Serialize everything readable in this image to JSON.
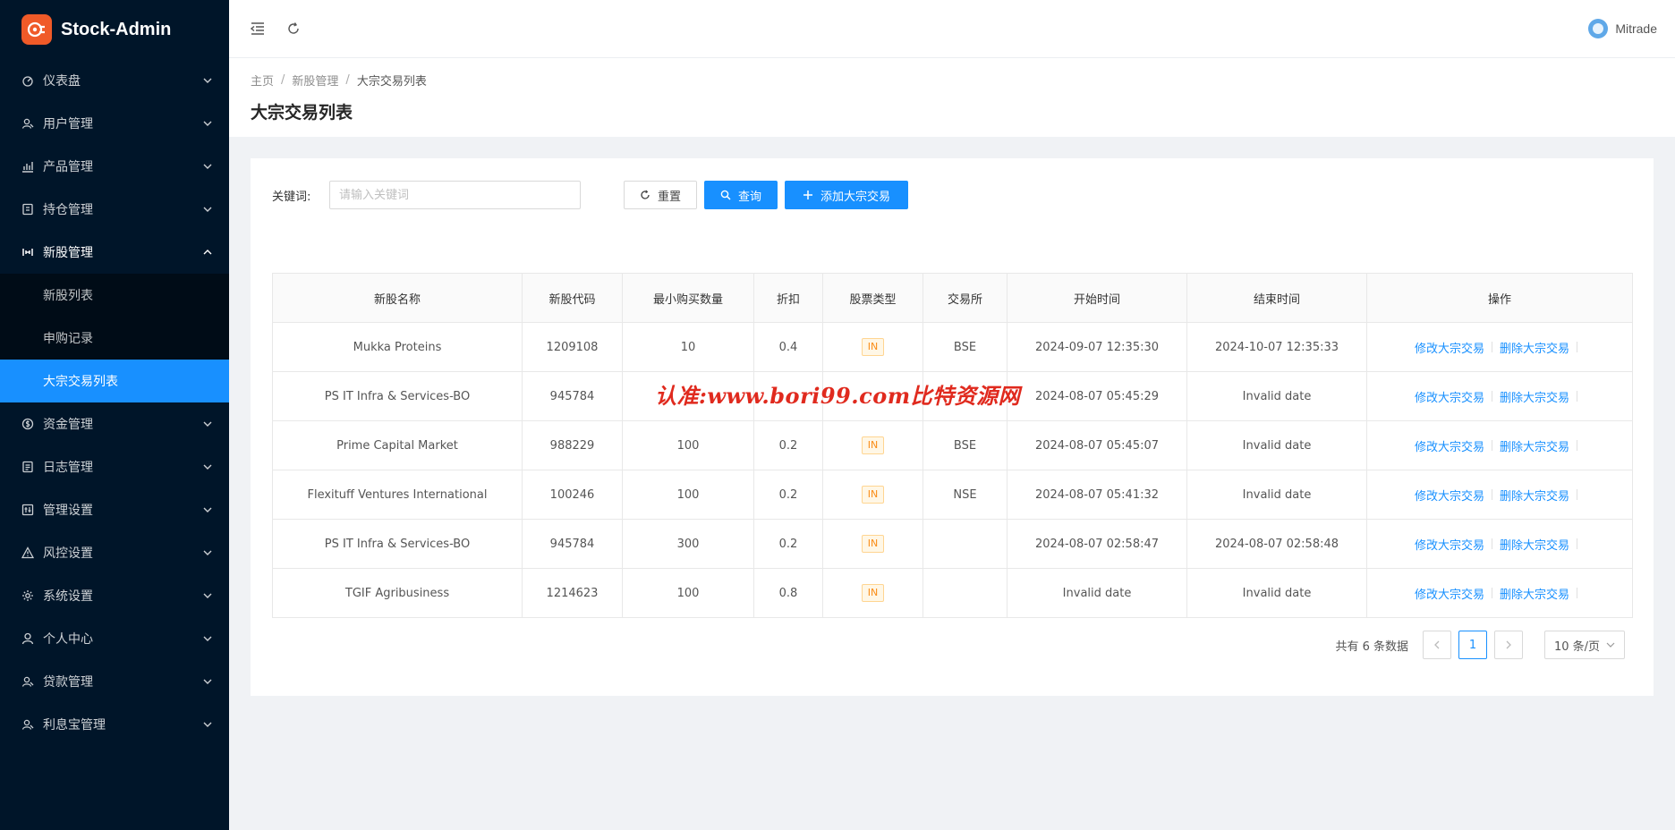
{
  "app": {
    "title": "Stock-Admin"
  },
  "sidebar": {
    "items": [
      {
        "label": "仪表盘",
        "icon": "dashboard-icon"
      },
      {
        "label": "用户管理",
        "icon": "users-icon"
      },
      {
        "label": "产品管理",
        "icon": "chart-icon"
      },
      {
        "label": "持仓管理",
        "icon": "position-icon"
      },
      {
        "label": "新股管理",
        "icon": "ipo-icon",
        "open": true
      },
      {
        "label": "资金管理",
        "icon": "money-icon"
      },
      {
        "label": "日志管理",
        "icon": "log-icon"
      },
      {
        "label": "管理设置",
        "icon": "admin-settings-icon"
      },
      {
        "label": "风控设置",
        "icon": "warning-icon"
      },
      {
        "label": "系统设置",
        "icon": "gear-icon"
      },
      {
        "label": "个人中心",
        "icon": "user-icon"
      },
      {
        "label": "贷款管理",
        "icon": "loan-icon"
      },
      {
        "label": "利息宝管理",
        "icon": "interest-icon"
      }
    ],
    "submenu": [
      {
        "label": "新股列表"
      },
      {
        "label": "申购记录"
      },
      {
        "label": "大宗交易列表",
        "active": true
      }
    ]
  },
  "header": {
    "username": "Mitrade"
  },
  "breadcrumb": [
    "主页",
    "新股管理",
    "大宗交易列表"
  ],
  "page_title": "大宗交易列表",
  "filter": {
    "label": "关键词:",
    "placeholder": "请输入关键词",
    "reset_label": "重置",
    "search_label": "查询",
    "add_label": "添加大宗交易"
  },
  "table": {
    "columns": [
      "新股名称",
      "新股代码",
      "最小购买数量",
      "折扣",
      "股票类型",
      "交易所",
      "开始时间",
      "结束时间",
      "操作"
    ],
    "rows": [
      {
        "name": "Mukka Proteins",
        "code": "1209108",
        "min_qty": "10",
        "discount": "0.4",
        "type": "IN",
        "exchange": "BSE",
        "start": "2024-09-07 12:35:30",
        "end": "2024-10-07 12:35:33"
      },
      {
        "name": "PS IT Infra & Services-BO",
        "code": "945784",
        "min_qty": "",
        "discount": "",
        "type": "",
        "exchange": "",
        "start": "2024-08-07 05:45:29",
        "end": "Invalid date"
      },
      {
        "name": "Prime Capital Market",
        "code": "988229",
        "min_qty": "100",
        "discount": "0.2",
        "type": "IN",
        "exchange": "BSE",
        "start": "2024-08-07 05:45:07",
        "end": "Invalid date"
      },
      {
        "name": "Flexituff Ventures International",
        "code": "100246",
        "min_qty": "100",
        "discount": "0.2",
        "type": "IN",
        "exchange": "NSE",
        "start": "2024-08-07 05:41:32",
        "end": "Invalid date"
      },
      {
        "name": "PS IT Infra & Services-BO",
        "code": "945784",
        "min_qty": "300",
        "discount": "0.2",
        "type": "IN",
        "exchange": "",
        "start": "2024-08-07 02:58:47",
        "end": "2024-08-07 02:58:48"
      },
      {
        "name": "TGIF Agribusiness",
        "code": "1214623",
        "min_qty": "100",
        "discount": "0.8",
        "type": "IN",
        "exchange": "",
        "start": "Invalid date",
        "end": "Invalid date"
      }
    ],
    "edit_label": "修改大宗交易",
    "delete_label": "删除大宗交易"
  },
  "pagination": {
    "total_text": "共有 6 条数据",
    "current_page": "1",
    "page_size": "10 条/页"
  },
  "watermark": "认准:www.bori99.com比特资源网",
  "colors": {
    "sidebar_bg": "#001529",
    "primary": "#1890ff",
    "logo": "#f05a28",
    "tag": "#fa8c16"
  }
}
